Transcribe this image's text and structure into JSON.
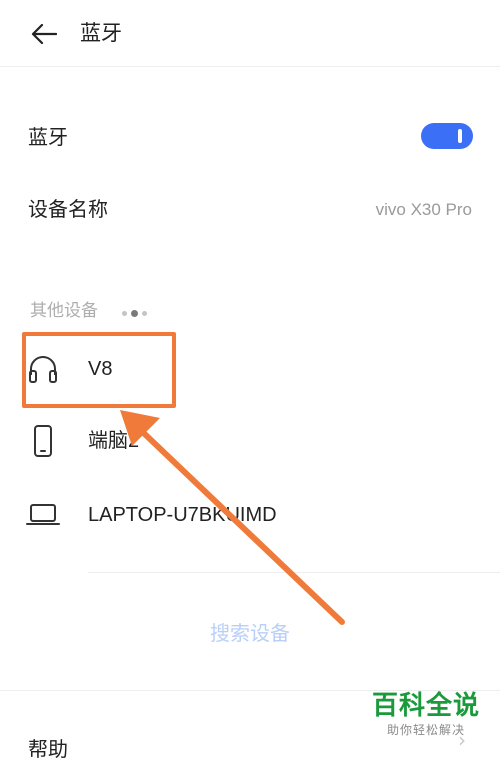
{
  "header": {
    "title": "蓝牙"
  },
  "bluetooth": {
    "label": "蓝牙",
    "enabled": true
  },
  "device_name": {
    "label": "设备名称",
    "value": "vivo X30 Pro"
  },
  "other_devices": {
    "label": "其他设备",
    "devices": [
      {
        "name": "V8",
        "icon": "headphones-icon"
      },
      {
        "name": "端脑2",
        "icon": "phone-icon"
      },
      {
        "name": "LAPTOP-U7BKUIMD",
        "icon": "laptop-icon"
      }
    ]
  },
  "search_button": {
    "label": "搜索设备"
  },
  "help": {
    "label": "帮助"
  },
  "watermark": {
    "title": "百科全说",
    "subtitle": "助你轻松解决"
  },
  "colors": {
    "accent": "#3a6ff6",
    "annotation": "#f07a3a",
    "watermark": "#1b9a3c"
  }
}
